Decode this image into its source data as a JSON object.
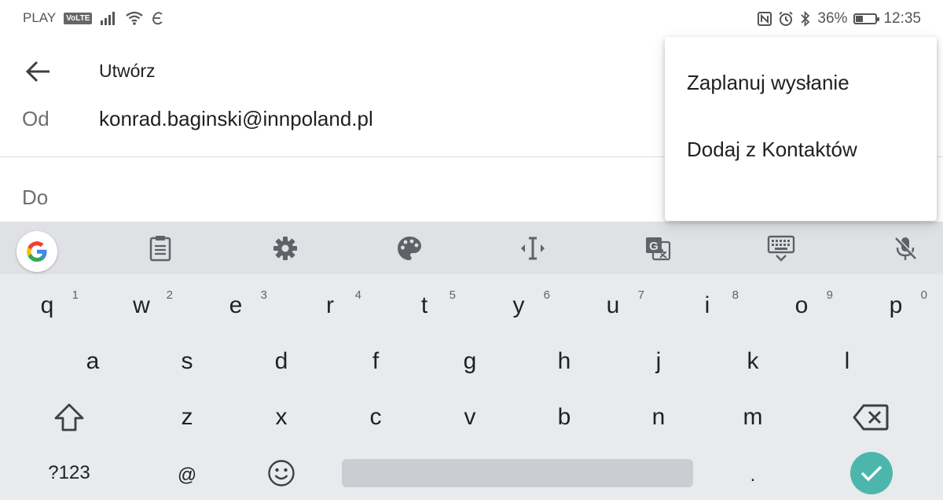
{
  "status_bar": {
    "carrier": "PLAY",
    "volte": "VoLTE",
    "battery": "36%",
    "battery_level": 0.36,
    "time": "12:35",
    "left_icons": [
      "signal-icon",
      "wifi-icon",
      "e-icon"
    ],
    "right_icons": [
      "nfc-icon",
      "alarm-icon",
      "bluetooth-icon",
      "battery-icon"
    ]
  },
  "compose": {
    "title": "Utwórz",
    "from_label": "Od",
    "from_value": "konrad.baginski@innpoland.pl",
    "to_label": "Do"
  },
  "menu": {
    "items": [
      "Zaplanuj wysłanie",
      "Dodaj z Kontaktów"
    ]
  },
  "keyboard": {
    "toolbar_icons": [
      "google-icon",
      "clipboard-icon",
      "gear-icon",
      "palette-icon",
      "text-cursor-icon",
      "translate-icon",
      "keyboard-icon",
      "mic-off-icon"
    ],
    "row1": [
      "q",
      "w",
      "e",
      "r",
      "t",
      "y",
      "u",
      "i",
      "o",
      "p"
    ],
    "row1_hints": [
      "1",
      "2",
      "3",
      "4",
      "5",
      "6",
      "7",
      "8",
      "9",
      "0"
    ],
    "row2": [
      "a",
      "s",
      "d",
      "f",
      "g",
      "h",
      "j",
      "k",
      "l"
    ],
    "row3": [
      "z",
      "x",
      "c",
      "v",
      "b",
      "n",
      "m"
    ],
    "row4": {
      "symbols": "?123",
      "at": "@",
      "period": "."
    },
    "accent_color": "#4db6ac"
  }
}
